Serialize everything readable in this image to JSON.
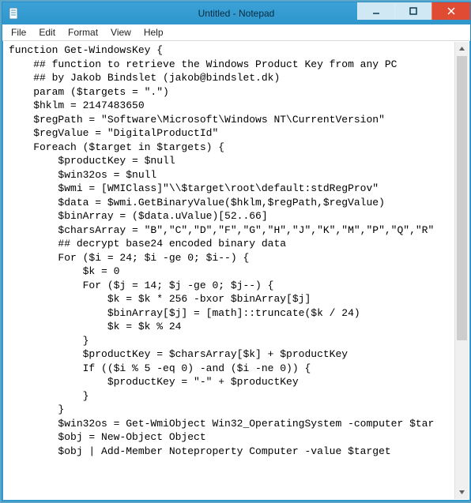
{
  "window": {
    "title": "Untitled - Notepad"
  },
  "menu": {
    "file": "File",
    "edit": "Edit",
    "format": "Format",
    "view": "View",
    "help": "Help"
  },
  "editor": {
    "content": "function Get-WindowsKey {\n    ## function to retrieve the Windows Product Key from any PC\n    ## by Jakob Bindslet (jakob@bindslet.dk)\n    param ($targets = \".\")\n    $hklm = 2147483650\n    $regPath = \"Software\\Microsoft\\Windows NT\\CurrentVersion\"\n    $regValue = \"DigitalProductId\"\n    Foreach ($target in $targets) {\n        $productKey = $null\n        $win32os = $null\n        $wmi = [WMIClass]\"\\\\$target\\root\\default:stdRegProv\"\n        $data = $wmi.GetBinaryValue($hklm,$regPath,$regValue)\n        $binArray = ($data.uValue)[52..66]\n        $charsArray = \"B\",\"C\",\"D\",\"F\",\"G\",\"H\",\"J\",\"K\",\"M\",\"P\",\"Q\",\"R\"\n        ## decrypt base24 encoded binary data\n        For ($i = 24; $i -ge 0; $i--) {\n            $k = 0\n            For ($j = 14; $j -ge 0; $j--) {\n                $k = $k * 256 -bxor $binArray[$j]\n                $binArray[$j] = [math]::truncate($k / 24)\n                $k = $k % 24\n            }\n            $productKey = $charsArray[$k] + $productKey\n            If (($i % 5 -eq 0) -and ($i -ne 0)) {\n                $productKey = \"-\" + $productKey\n            }\n        }\n        $win32os = Get-WmiObject Win32_OperatingSystem -computer $tar\n        $obj = New-Object Object\n        $obj | Add-Member Noteproperty Computer -value $target"
  }
}
